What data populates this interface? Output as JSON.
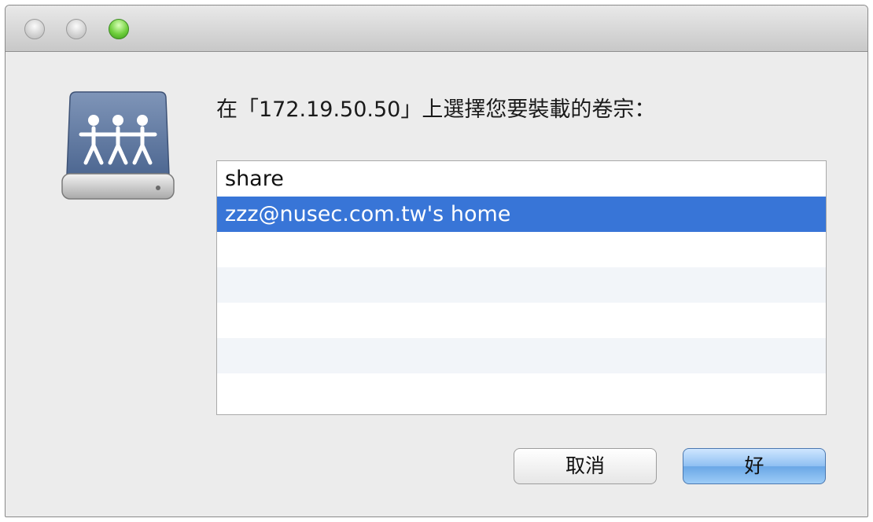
{
  "dialog": {
    "prompt": "在「172.19.50.50」上選擇您要裝載的卷宗：",
    "icon": "network-share-drive-icon"
  },
  "volumes": [
    {
      "label": "share",
      "selected": false
    },
    {
      "label": "zzz@nusec.com.tw's home",
      "selected": true
    },
    {
      "label": "",
      "selected": false
    },
    {
      "label": "",
      "selected": false
    },
    {
      "label": "",
      "selected": false
    },
    {
      "label": "",
      "selected": false
    },
    {
      "label": "",
      "selected": false
    }
  ],
  "buttons": {
    "cancel": "取消",
    "ok": "好"
  },
  "colors": {
    "selection": "#3875d7",
    "stripe": "#f2f5f9",
    "zoom_button": "#6fcf3c"
  }
}
